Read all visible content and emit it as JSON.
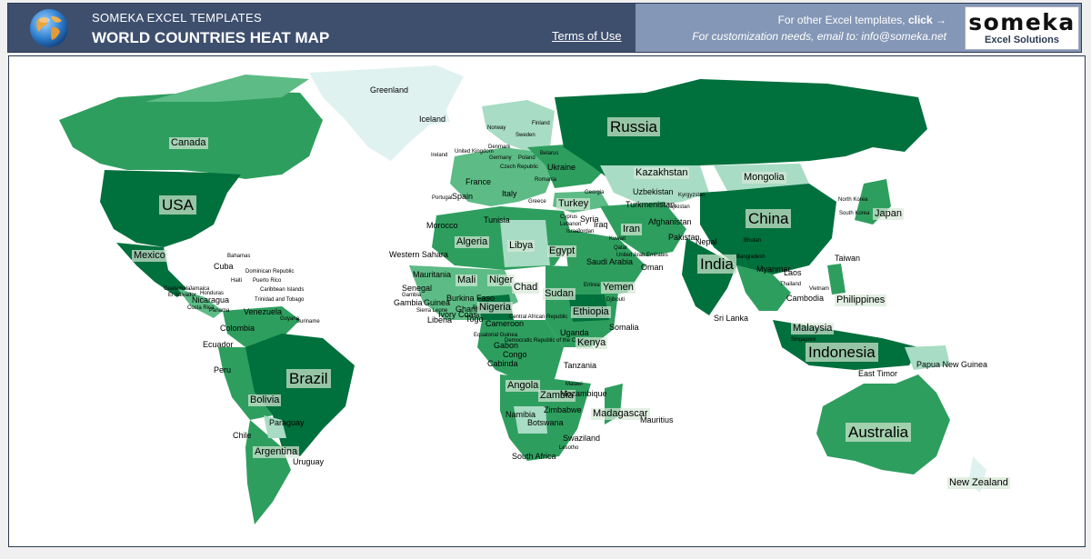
{
  "header": {
    "brand": "SOMEKA EXCEL TEMPLATES",
    "title": "WORLD COUNTRIES HEAT MAP",
    "terms_link": "Terms of Use",
    "promo_line1": "For other Excel templates, click →",
    "promo_line1_prefix": "For other Excel templates, ",
    "promo_line1_link": "click",
    "promo_line1_arrow": "→",
    "promo_line2": "For customization needs, email to: info@someka.net",
    "logo_text": "someka",
    "logo_subtext": "Excel Solutions",
    "globe_icon": "globe-icon",
    "colors": {
      "header_bg": "#3e4f6e",
      "header_right_bg": "#8497b6",
      "header_text": "#ffffff"
    }
  },
  "map": {
    "legend_scale": {
      "dark": "#00703c",
      "medium": "#2e9e5e",
      "light": "#5dbb85",
      "pale": "#a8dcc4",
      "palest": "#dff2f0"
    },
    "labels": [
      {
        "text": "Russia",
        "size": "big"
      },
      {
        "text": "China",
        "size": "big"
      },
      {
        "text": "USA",
        "size": "big"
      },
      {
        "text": "Brazil",
        "size": "big"
      },
      {
        "text": "Australia",
        "size": "big"
      },
      {
        "text": "India",
        "size": "big"
      },
      {
        "text": "Indonesia",
        "size": "big"
      },
      {
        "text": "Canada",
        "size": "mid"
      },
      {
        "text": "Kazakhstan",
        "size": "mid"
      },
      {
        "text": "Mongolia",
        "size": "mid"
      },
      {
        "text": "Algeria",
        "size": "mid"
      },
      {
        "text": "Libya",
        "size": "mid"
      },
      {
        "text": "Egypt",
        "size": "mid"
      },
      {
        "text": "Sudan",
        "size": "mid"
      },
      {
        "text": "Chad",
        "size": "mid"
      },
      {
        "text": "Niger",
        "size": "mid"
      },
      {
        "text": "Mali",
        "size": "mid"
      },
      {
        "text": "Nigeria",
        "size": "mid"
      },
      {
        "text": "Ethiopia",
        "size": "mid"
      },
      {
        "text": "Angola",
        "size": "mid"
      },
      {
        "text": "Iran",
        "size": "mid"
      },
      {
        "text": "Turkey",
        "size": "mid"
      },
      {
        "text": "Yemen",
        "size": "mid"
      },
      {
        "text": "Bolivia",
        "size": "mid"
      },
      {
        "text": "Madagascar",
        "size": "mid"
      },
      {
        "text": "Argentina",
        "size": "mid"
      },
      {
        "text": "Mexico",
        "size": "mid"
      },
      {
        "text": "Kenya",
        "size": "mid"
      },
      {
        "text": "Zambia",
        "size": "mid"
      },
      {
        "text": "Greenland",
        "size": "sm"
      },
      {
        "text": "Iceland",
        "size": "sm"
      },
      {
        "text": "Philippines",
        "size": "mid"
      },
      {
        "text": "New Zealand",
        "size": "mid"
      },
      {
        "text": "Papua New Guinea",
        "size": "sm"
      },
      {
        "text": "Malaysia",
        "size": "mid"
      },
      {
        "text": "Japan",
        "size": "mid"
      },
      {
        "text": "Taiwan",
        "size": "sm"
      },
      {
        "text": "Oman",
        "size": "sm"
      },
      {
        "text": "Saudi Arabia",
        "size": "sm"
      },
      {
        "text": "Afghanistan",
        "size": "sm"
      },
      {
        "text": "Pakistan",
        "size": "sm"
      },
      {
        "text": "Uzbekistan",
        "size": "sm"
      },
      {
        "text": "Turkmenistan",
        "size": "sm"
      },
      {
        "text": "Ukraine",
        "size": "sm"
      },
      {
        "text": "Morocco",
        "size": "sm"
      },
      {
        "text": "Western Sahara",
        "size": "sm"
      },
      {
        "text": "Mauritania",
        "size": "sm"
      },
      {
        "text": "Tunisia",
        "size": "sm"
      },
      {
        "text": "Somalia",
        "size": "sm"
      },
      {
        "text": "Tanzania",
        "size": "sm"
      },
      {
        "text": "Namibia",
        "size": "sm"
      },
      {
        "text": "Botswana",
        "size": "sm"
      },
      {
        "text": "South Africa",
        "size": "sm"
      },
      {
        "text": "Chile",
        "size": "sm"
      },
      {
        "text": "Peru",
        "size": "sm"
      },
      {
        "text": "Colombia",
        "size": "sm"
      },
      {
        "text": "Venezuela",
        "size": "sm"
      },
      {
        "text": "Paraguay",
        "size": "sm"
      },
      {
        "text": "Uruguay",
        "size": "sm"
      },
      {
        "text": "Ecuador",
        "size": "sm"
      },
      {
        "text": "Cuba",
        "size": "sm"
      },
      {
        "text": "Nicaragua",
        "size": "sm"
      },
      {
        "text": "Sri Lanka",
        "size": "sm"
      },
      {
        "text": "East Timor",
        "size": "sm"
      },
      {
        "text": "Mauritius",
        "size": "sm"
      },
      {
        "text": "France",
        "size": "sm"
      },
      {
        "text": "Spain",
        "size": "sm"
      },
      {
        "text": "Italy",
        "size": "sm"
      },
      {
        "text": "Sweden",
        "size": "sm"
      },
      {
        "text": "Finland",
        "size": "sm"
      },
      {
        "text": "Norway",
        "size": "sm"
      },
      {
        "text": "Iraq",
        "size": "sm"
      },
      {
        "text": "Syria",
        "size": "sm"
      },
      {
        "text": "Cameroon",
        "size": "sm"
      },
      {
        "text": "Gabon",
        "size": "sm"
      },
      {
        "text": "Congo",
        "size": "sm"
      },
      {
        "text": "Cabinda",
        "size": "sm"
      },
      {
        "text": "Zimbabwe",
        "size": "sm"
      },
      {
        "text": "Mozambique",
        "size": "sm"
      },
      {
        "text": "Swaziland",
        "size": "sm"
      },
      {
        "text": "Lesotho",
        "size": "sm"
      },
      {
        "text": "Uganda",
        "size": "sm"
      },
      {
        "text": "Djibouti",
        "size": "sm"
      },
      {
        "text": "Eritrea",
        "size": "sm"
      },
      {
        "text": "Ireland",
        "size": "sm"
      },
      {
        "text": "Portugal",
        "size": "sm"
      },
      {
        "text": "Greece",
        "size": "sm"
      },
      {
        "text": "Myanmar",
        "size": "sm"
      },
      {
        "text": "Thailand",
        "size": "sm"
      },
      {
        "text": "Vietnam",
        "size": "sm"
      },
      {
        "text": "Laos",
        "size": "sm"
      },
      {
        "text": "Cambodia",
        "size": "sm"
      },
      {
        "text": "Singapore",
        "size": "sm"
      },
      {
        "text": "Bangladesh",
        "size": "sm"
      },
      {
        "text": "Nepal",
        "size": "sm"
      },
      {
        "text": "Bhutan",
        "size": "sm"
      },
      {
        "text": "North Korea",
        "size": "sm"
      },
      {
        "text": "South Korea",
        "size": "sm"
      },
      {
        "text": "Kyrgyzstan",
        "size": "sm"
      },
      {
        "text": "Tajikistan",
        "size": "sm"
      },
      {
        "text": "Georgia",
        "size": "sm"
      },
      {
        "text": "Central African Republic",
        "size": "tiny"
      },
      {
        "text": "Democratic Republic of the Congo",
        "size": "tiny"
      },
      {
        "text": "Burkina Faso",
        "size": "sm"
      },
      {
        "text": "Senegal",
        "size": "sm"
      },
      {
        "text": "Guinea",
        "size": "sm"
      },
      {
        "text": "Guinea-Bissau",
        "size": "sm"
      },
      {
        "text": "Gambia",
        "size": "tiny"
      },
      {
        "text": "Sierra Leone",
        "size": "tiny"
      },
      {
        "text": "Liberia",
        "size": "sm"
      },
      {
        "text": "Ivory Coast",
        "size": "sm"
      },
      {
        "text": "Ghana",
        "size": "sm"
      },
      {
        "text": "Togo",
        "size": "sm"
      },
      {
        "text": "Benin",
        "size": "tiny"
      },
      {
        "text": "Equatorial Guinea",
        "size": "tiny"
      },
      {
        "text": "Jordan",
        "size": "tiny"
      },
      {
        "text": "Cyprus",
        "size": "tiny"
      },
      {
        "text": "Lebanon",
        "size": "tiny"
      },
      {
        "text": "Israel",
        "size": "tiny"
      },
      {
        "text": "Kuwait",
        "size": "tiny"
      },
      {
        "text": "Qatar",
        "size": "tiny"
      },
      {
        "text": "United Arab Emirates",
        "size": "tiny"
      },
      {
        "text": "United Kingdom",
        "size": "tiny"
      },
      {
        "text": "Germany",
        "size": "tiny"
      },
      {
        "text": "Poland",
        "size": "tiny"
      },
      {
        "text": "Belarus",
        "size": "tiny"
      },
      {
        "text": "Denmark",
        "size": "tiny"
      },
      {
        "text": "Romania",
        "size": "tiny"
      },
      {
        "text": "Czech Republic",
        "size": "tiny"
      },
      {
        "text": "Estonia",
        "size": "tiny"
      },
      {
        "text": "Latvia",
        "size": "tiny"
      },
      {
        "text": "Lithuania",
        "size": "tiny"
      },
      {
        "text": "Bahamas",
        "size": "tiny"
      },
      {
        "text": "Dominican Republic",
        "size": "tiny"
      },
      {
        "text": "Puerto Rico",
        "size": "tiny"
      },
      {
        "text": "Jamaica",
        "size": "tiny"
      },
      {
        "text": "Haiti",
        "size": "tiny"
      },
      {
        "text": "Caribbean Islands",
        "size": "tiny"
      },
      {
        "text": "Guatemala",
        "size": "tiny"
      },
      {
        "text": "Honduras",
        "size": "tiny"
      },
      {
        "text": "El Salvador",
        "size": "tiny"
      },
      {
        "text": "Belize",
        "size": "tiny"
      },
      {
        "text": "Costa Rica",
        "size": "tiny"
      },
      {
        "text": "Panama",
        "size": "tiny"
      },
      {
        "text": "Trinidad and Tobago",
        "size": "tiny"
      },
      {
        "text": "Guyana",
        "size": "tiny"
      },
      {
        "text": "Suriname",
        "size": "tiny"
      },
      {
        "text": "French Guiana",
        "size": "tiny"
      },
      {
        "text": "Malawi",
        "size": "tiny"
      }
    ]
  }
}
